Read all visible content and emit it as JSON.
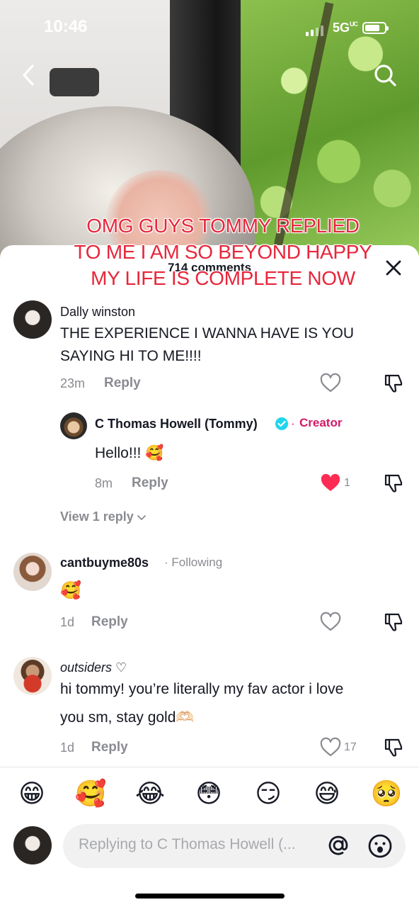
{
  "status_bar": {
    "time": "10:46",
    "network": "5G",
    "network_sup": "UC"
  },
  "overlay_caption": "OMG GUYS TOMMY REPLIED TO ME I AM SO BEYOND HAPPY MY LIFE IS COMPLETE NOW",
  "sheet": {
    "title": "714 comments"
  },
  "comments": [
    {
      "username": "Dally winston",
      "text": "THE EXPERIENCE I WANNA HAVE IS YOU SAYING HI TO ME!!!!",
      "time": "23m",
      "reply_label": "Reply",
      "replies": [
        {
          "username": "C Thomas Howell (Tommy)",
          "verified": true,
          "badge": "Creator",
          "text": "Hello!!! 🥰",
          "time": "8m",
          "reply_label": "Reply",
          "likes": "1",
          "liked": true
        }
      ],
      "view_replies": "View 1 reply"
    },
    {
      "username": "cantbuyme80s",
      "badge": "Following",
      "text": "🥰",
      "time": "1d",
      "reply_label": "Reply"
    },
    {
      "username": "outsiders ♡",
      "text_line1": "hi tommy! you’re literally my fav actor i love",
      "text_line2": "you sm, stay gold🫶🏻",
      "time": "1d",
      "reply_label": "Reply",
      "likes": "17"
    }
  ],
  "emoji_bar": [
    "😁",
    "🥰",
    "😂",
    "😳",
    "😏",
    "😅",
    "🥺"
  ],
  "input": {
    "placeholder": "Replying to C Thomas Howell (..."
  },
  "colors": {
    "accent": "#fe2c55",
    "creator": "#d51967",
    "verified": "#20d5ec",
    "caption": "#e8263b"
  },
  "icons": [
    "back-icon",
    "search-icon",
    "close-icon",
    "heart-icon",
    "dislike-icon",
    "verified-icon",
    "chevron-down-icon",
    "at-icon",
    "emoji-icon"
  ]
}
